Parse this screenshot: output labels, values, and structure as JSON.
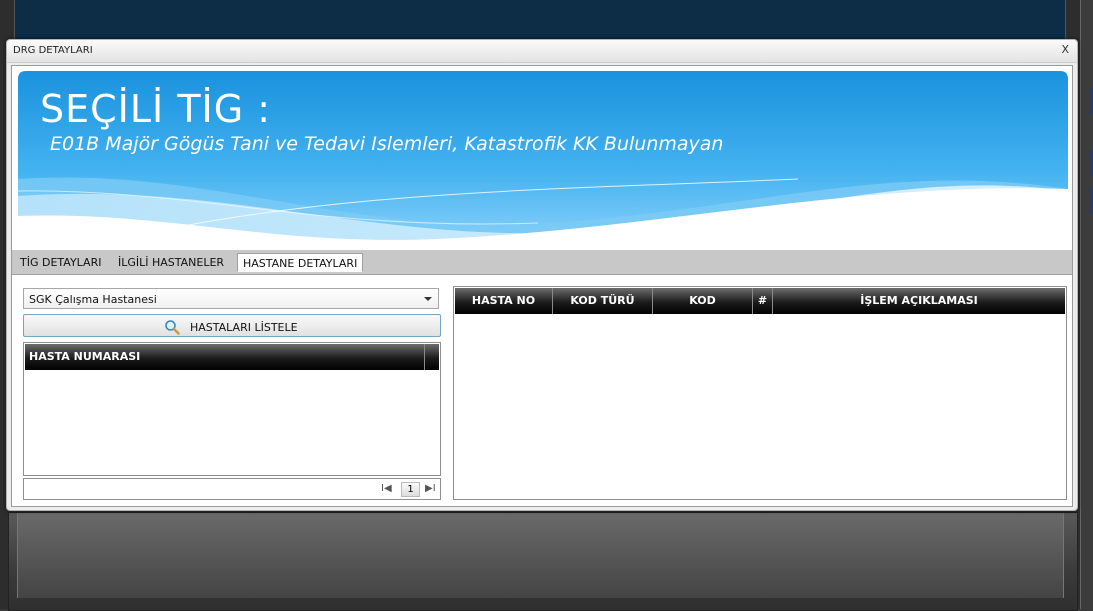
{
  "dialog": {
    "title": "DRG DETAYLARI",
    "close_label": "X"
  },
  "banner": {
    "title": "SEÇİLİ TİG :",
    "subtitle": "E01B Majör Gögüs Tani ve Tedavi Islemleri, Katastrofik KK Bulunmayan"
  },
  "tabs": [
    {
      "label": "TİG DETAYLARI",
      "active": false
    },
    {
      "label": "İLGİLİ HASTANELER",
      "active": false
    },
    {
      "label": "HASTANE DETAYLARI",
      "active": true
    }
  ],
  "left_panel": {
    "hospital_select_value": "SGK Çalışma Hastanesi",
    "list_button_label": "HASTALARI LİSTELE",
    "grid_columns": [
      "HASTA NUMARASI"
    ],
    "pager": {
      "first": "I◀",
      "current_page": "1",
      "last": "▶I"
    }
  },
  "right_panel": {
    "grid_columns": [
      "HASTA NO",
      "KOD TÜRÜ",
      "KOD",
      "#",
      "İŞLEM AÇIKLAMASI"
    ]
  },
  "colors": {
    "banner_blue": "#1e9be4",
    "grid_header": "#000000",
    "button_border": "#6fa8c4"
  }
}
